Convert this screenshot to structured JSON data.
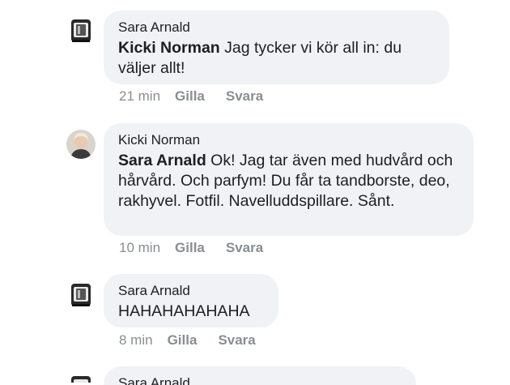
{
  "comments": [
    {
      "author": "Sara Arnald",
      "mention": "Kicki Norman",
      "text": " Jag tycker vi kör all in: du väljer allt!",
      "time": "21 min",
      "like": "Gilla",
      "reply": "Svara",
      "avatar_icon": "mixer-appliance-avatar"
    },
    {
      "author": "Kicki Norman",
      "mention": "Sara Arnald",
      "text": " Ok! Jag tar även med hudvård och hårvård. Och parfym! Du får ta tandborste, deo, rakhyvel. Fotfil. Navelluddspillare. Sånt.",
      "time": "10 min",
      "like": "Gilla",
      "reply": "Svara",
      "avatar_icon": "profile-photo-avatar"
    },
    {
      "author": "Sara Arnald",
      "mention": "",
      "text": "HAHAHAHAHAHA",
      "time": "8 min",
      "like": "Gilla",
      "reply": "Svara",
      "avatar_icon": "mixer-appliance-avatar"
    },
    {
      "author": "Sara Arnald",
      "avatar_icon": "mixer-appliance-avatar"
    }
  ],
  "colors": {
    "bubble": "#f0f2f5",
    "text": "#1c1e21",
    "meta": "#8a8d91"
  }
}
